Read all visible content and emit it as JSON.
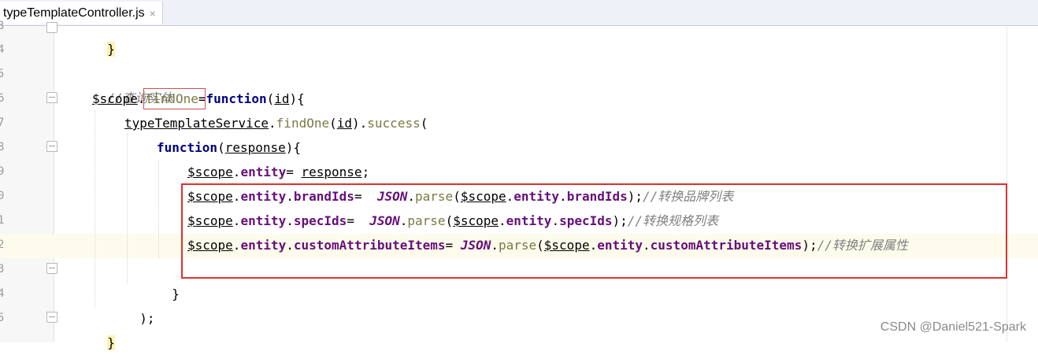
{
  "tab": {
    "filename": "typeTemplateController.js",
    "close_glyph": "×"
  },
  "gutter": {
    "line_numbers": [
      "3",
      "4",
      "5",
      "6",
      "7",
      "8",
      "9",
      "0",
      "1",
      "2",
      "3",
      "4",
      "5"
    ]
  },
  "code": {
    "l0_brace": "}",
    "l2_comment": "//查询实体",
    "l3_scope": "$scope",
    "l3_dot": ".",
    "l3_findone": "findOne",
    "l3_eq": "=",
    "l3_function": "function",
    "l3_paren_open": "(",
    "l3_id": "id",
    "l3_tail": "){",
    "l4_service": "typeTemplateService",
    "l4_dot": ".",
    "l4_findone": "findOne",
    "l4_paren_open": "(",
    "l4_id": "id",
    "l4_mid": ").",
    "l4_success": "success",
    "l4_tail": "(",
    "l5_function": "function",
    "l5_paren_open": "(",
    "l5_response": "response",
    "l5_tail": "){",
    "l6_scope": "$scope",
    "l6_dot": ".",
    "l6_entity": "entity",
    "l6_eq": "= ",
    "l6_response": "response",
    "l6_tail": ";",
    "l7_scope": "$scope",
    "l7_entity": "entity",
    "l7_brandIds": "brandIds",
    "l7_eq": "=  ",
    "l7_json": "JSON",
    "l7_parse": "parse",
    "l7_scope2": "$scope",
    "l7_entity2": "entity",
    "l7_brandIds2": "brandIds",
    "l7_comment": "//转换品牌列表",
    "l8_scope": "$scope",
    "l8_entity": "entity",
    "l8_specIds": "specIds",
    "l8_eq": "=  ",
    "l8_json": "JSON",
    "l8_parse": "parse",
    "l8_scope2": "$scope",
    "l8_entity2": "entity",
    "l8_specIds2": "specIds",
    "l8_comment": "//转换规格列表",
    "l9_scope": "$scope",
    "l9_entity": "entity",
    "l9_custom": "customAttributeItems",
    "l9_eq": "= ",
    "l9_json": "JSON",
    "l9_parse": "parse",
    "l9_scope2": "$scope",
    "l9_entity2": "entity",
    "l9_custom2": "customAttributeItems",
    "l9_comment": "//转换扩展属性",
    "l10_brace": "}",
    "l11_close": ");",
    "l12_brace": "}"
  },
  "watermark": "CSDN @Daniel521-Spark",
  "colors": {
    "keyword": "#000080",
    "property": "#660e7a",
    "function_call": "#7a7a43",
    "comment": "#808080",
    "annotation_box": "#e03030"
  }
}
